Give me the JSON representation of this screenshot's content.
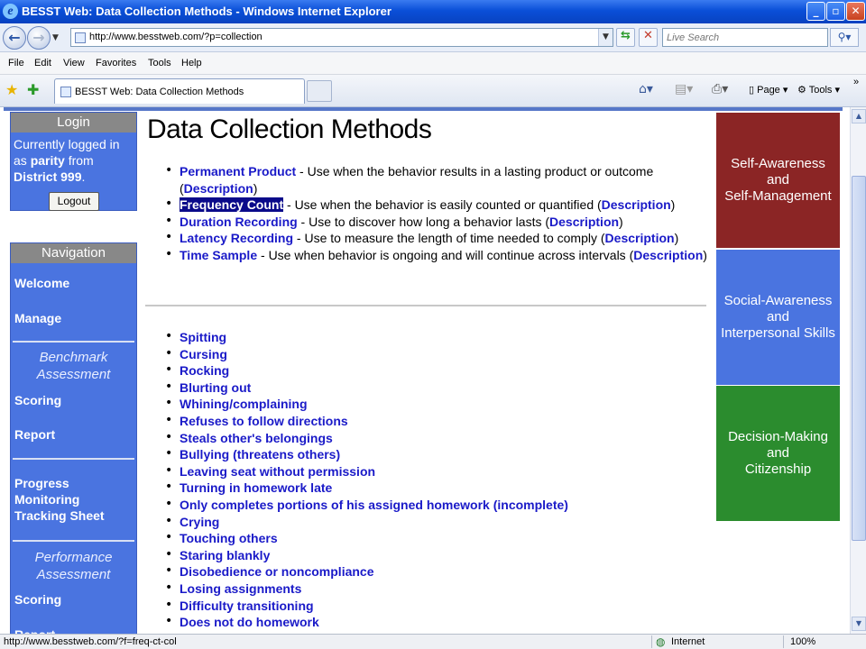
{
  "window": {
    "title": "BESST Web: Data Collection Methods - Windows Internet Explorer"
  },
  "address": {
    "url": "http://www.besstweb.com/?p=collection",
    "search_placeholder": "Live Search"
  },
  "menu": [
    "File",
    "Edit",
    "View",
    "Favorites",
    "Tools",
    "Help"
  ],
  "tab": {
    "label": "BESST Web: Data Collection Methods"
  },
  "commandbar": {
    "page_label": "Page",
    "tools_label": "Tools"
  },
  "login": {
    "heading": "Login",
    "line1": "Currently logged in as",
    "username": "parity",
    "from": "from",
    "district": "District 999",
    "period": ".",
    "logout_label": "Logout"
  },
  "navigation": {
    "heading": "Navigation",
    "welcome": "Welcome",
    "manage": "Manage",
    "benchmark": "Benchmark Assessment",
    "scoring1": "Scoring",
    "report1": "Report",
    "progress": "Progress Monitoring Tracking Sheet",
    "performance": "Performance Assessment",
    "scoring2": "Scoring",
    "report2": "Report"
  },
  "page": {
    "title": "Data Collection Methods"
  },
  "methods": [
    {
      "name": "Permanent Product",
      "desc": " - Use when the behavior results in a lasting product or outcome (",
      "link": "Description",
      "end": ")"
    },
    {
      "name": "Frequency Count",
      "desc": " - Use when the behavior is easily counted or quantified (",
      "link": "Description",
      "end": ")"
    },
    {
      "name": "Duration Recording",
      "desc": " - Use to discover how long a behavior lasts (",
      "link": "Description",
      "end": ")"
    },
    {
      "name": "Latency Recording",
      "desc": " - Use to measure the length of time needed to comply (",
      "link": "Description",
      "end": ")"
    },
    {
      "name": "Time Sample",
      "desc": " - Use when behavior is ongoing and will continue across intervals (",
      "link": "Description",
      "end": ")"
    }
  ],
  "behaviors": [
    "Spitting",
    "Cursing",
    "Rocking",
    "Blurting out",
    "Whining/complaining",
    "Refuses to follow directions",
    "Steals other's belongings",
    "Bullying (threatens others)",
    "Leaving seat without permission",
    "Turning in homework late",
    "Only completes portions of his assigned homework (incomplete)",
    "Crying",
    "Touching others",
    "Staring blankly",
    "Disobedience or noncompliance",
    "Losing assignments",
    "Difficulty transitioning",
    "Does not do homework"
  ],
  "sel_boxes": [
    {
      "label": "Self-Awareness\nand\nSelf-Management",
      "color": "#8b2525"
    },
    {
      "label": "Social-Awareness\nand\nInterpersonal Skills",
      "color": "#4a74e0"
    },
    {
      "label": "Decision-Making\nand\nCitizenship",
      "color": "#2b8c2e"
    }
  ],
  "status": {
    "text": "http://www.besstweb.com/?f=freq-ct-col",
    "zone": "Internet",
    "zoom": "100%"
  }
}
